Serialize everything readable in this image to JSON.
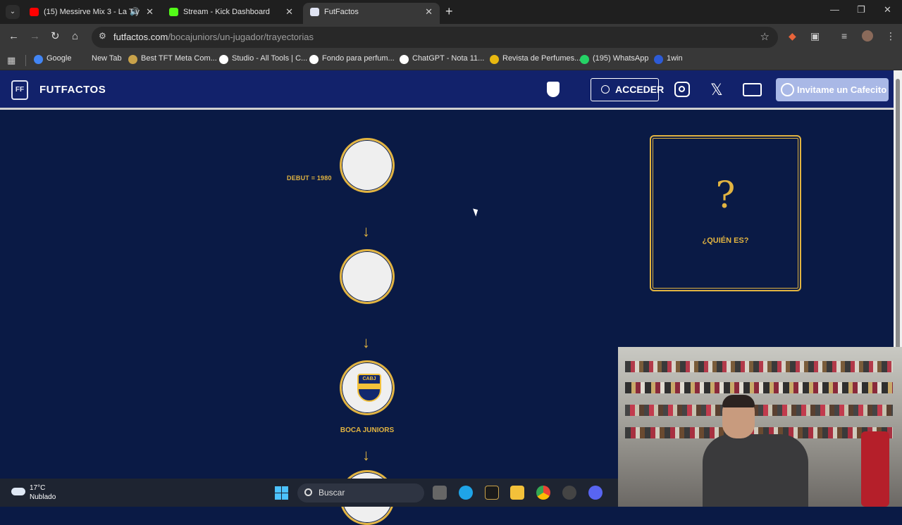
{
  "browser": {
    "tabs": [
      {
        "title": "(15) Messirve Mix 3 - La T y",
        "favicon_color": "#ff0000",
        "active": false
      },
      {
        "title": "Stream - Kick Dashboard",
        "favicon_color": "#53fc18",
        "active": false
      },
      {
        "title": "FutFactos",
        "favicon_color": "#dfe3f2",
        "active": true
      }
    ],
    "url_domain": "futfactos.com",
    "url_path": "/bocajuniors/un-jugador/trayectorias",
    "bookmarks": [
      {
        "label": "Google",
        "color": "#4285f4"
      },
      {
        "label": "New Tab",
        "color": "#383838"
      },
      {
        "label": "Best TFT Meta Com...",
        "color": "#c9a24a"
      },
      {
        "label": "Studio - All Tools | C...",
        "color": "#ffffff"
      },
      {
        "label": "Fondo para perfum...",
        "color": "#ffffff"
      },
      {
        "label": "ChatGPT - Nota 11...",
        "color": "#ffffff"
      },
      {
        "label": "Revista de Perfumes...",
        "color": "#e8b810"
      },
      {
        "label": "(195) WhatsApp",
        "color": "#25d366"
      },
      {
        "label": "1win",
        "color": "#2d5bd6"
      }
    ]
  },
  "site": {
    "logo_text": "FUTFACTOS",
    "login_label": "ACCEDER",
    "donate_label": "Invitame un Cafecito",
    "trajectory": {
      "debut_label": "DEBUT = 1980",
      "club_name": "BOCA JUNIORS",
      "crest_text": "CABJ"
    },
    "mystery_card": {
      "symbol": "?",
      "label": "¿QUIÉN ES?"
    }
  },
  "taskbar": {
    "temperature": "17°C",
    "condition": "Nublado",
    "search_placeholder": "Buscar"
  },
  "colors": {
    "site_bg": "#0a1a45",
    "header_bg": "#12226b",
    "accent_gold": "#e2b441"
  }
}
